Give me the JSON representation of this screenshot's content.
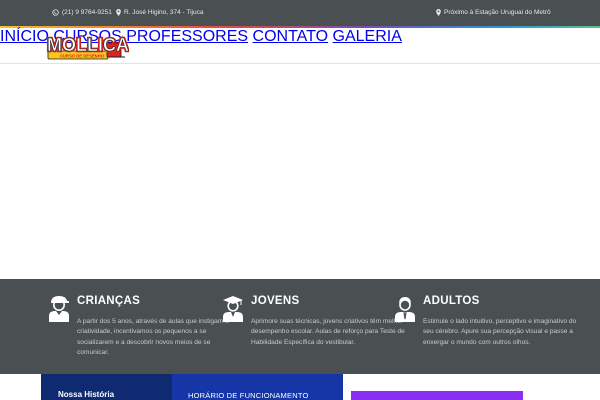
{
  "topbar": {
    "phone": "(21) 9 9764-9251",
    "address": "R. José Higino, 374 - Tijuca",
    "location_note": "Próximo à Estação Uruguai do Metrô"
  },
  "logo": {
    "name": "MOLLICA",
    "tagline": "CURSO DE DESENHO"
  },
  "nav": {
    "items": [
      "INÍCIO",
      "CURSOS",
      "PROFESSORES",
      "CONTATO",
      "GALERIA"
    ]
  },
  "features": [
    {
      "icon": "child-icon",
      "title": "CRIANÇAS",
      "text": "A partir dos 5 anos, através de aulas que instigam a criatividade, incentivamos os pequenos a se socializarem e a descobrir novos meios de se comunicar."
    },
    {
      "icon": "graduate-icon",
      "title": "JOVENS",
      "text": "Aprimore suas técnicas, jovens criativos têm melhor desempenho escolar. Aulas de reforço para Teste de Habilidade Específica do vestibular."
    },
    {
      "icon": "adult-icon",
      "title": "ADULTOS",
      "text": "Estimule o lado intuitivo, perceptivo e imaginativo do seu cérebro. Apure sua percepção visual e passe a enxergar o mundo com outros olhos."
    }
  ],
  "bottom": {
    "history_title": "Nossa História",
    "hours_title": "HORÁRIO DE FUNCIONAMENTO"
  },
  "colors": {
    "topbar": "#4a5052",
    "nav_text": "#9aa0a2",
    "history_bg": "#0f2a70",
    "hours_bg": "#1635a6",
    "accent_purple": "#8c2ff5",
    "logo_red": "#d7261e",
    "logo_yellow": "#f6c81e"
  }
}
